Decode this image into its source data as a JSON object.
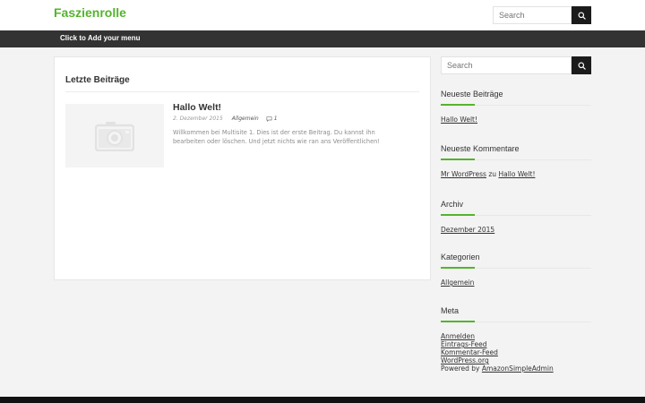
{
  "header": {
    "site_title": "Faszienrolle",
    "search_placeholder": "Search"
  },
  "nav": {
    "menu_label": "Click to Add your menu"
  },
  "main": {
    "section_title": "Letzte Beiträge",
    "posts": [
      {
        "title": "Hallo Welt!",
        "date": "2. Dezember 2015",
        "category": "Allgemein",
        "comments": "1",
        "excerpt": "Willkommen bei Multisite 1. Dies ist der erste Beitrag. Du kannst ihn bearbeiten oder löschen. Und jetzt nichts wie ran ans Veröffentlichen!"
      }
    ]
  },
  "sidebar": {
    "search_placeholder": "Search",
    "recent_posts": {
      "title": "Neueste Beiträge",
      "items": [
        "Hallo Welt!"
      ]
    },
    "recent_comments": {
      "title": "Neueste Kommentare",
      "author": "Mr WordPress",
      "connector": "zu",
      "post": "Hallo Welt!"
    },
    "archive": {
      "title": "Archiv",
      "items": [
        "Dezember 2015"
      ]
    },
    "categories": {
      "title": "Kategorien",
      "items": [
        "Allgemein"
      ]
    },
    "meta": {
      "title": "Meta",
      "links": [
        "Anmelden",
        "Eintrags-Feed",
        "Kommentar-Feed",
        "WordPress.org"
      ],
      "powered_prefix": "Powered by",
      "powered_link": "AmazonSimpleAdmin"
    }
  },
  "colors": {
    "brand_green": "#54b42c",
    "nav_bg": "#333333",
    "search_button": "#1b1b1b",
    "footer_bg": "#111111"
  },
  "icons": {
    "search": "search-icon",
    "comment": "comment-icon",
    "placeholder": "camera-icon"
  }
}
